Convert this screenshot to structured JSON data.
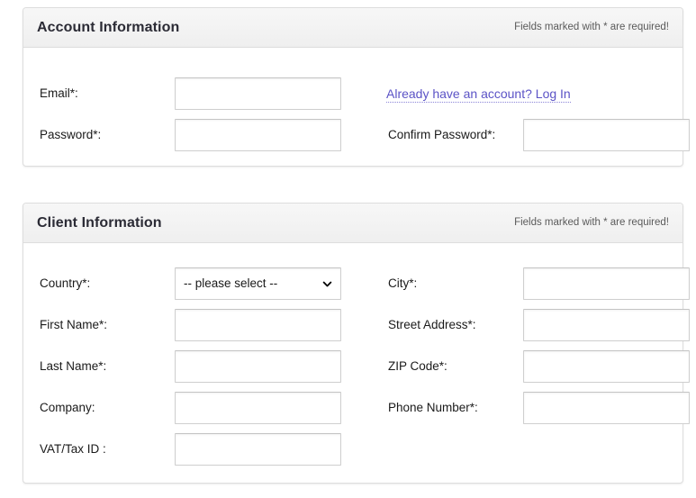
{
  "theme": {
    "panel_border": "#dddddd",
    "header_gradient_top": "#f7f7f7",
    "header_gradient_bottom": "#efefef",
    "title_color": "#2b2b35",
    "link_color": "#5b53c6",
    "input_border": "#cfcfcf",
    "page_background": "#ffffff"
  },
  "panels": [
    {
      "id": "account",
      "title": "Account Information",
      "hint": "Fields marked with * are required!",
      "rows": [
        {
          "left": {
            "kind": "input",
            "label": "Email*:",
            "value": "",
            "placeholder": ""
          },
          "right": {
            "kind": "link",
            "label": "Already have an account? Log In"
          }
        },
        {
          "left": {
            "kind": "input",
            "label": "Password*:",
            "value": "",
            "placeholder": ""
          },
          "right": {
            "kind": "input",
            "label": "Confirm Password*:",
            "value": "",
            "placeholder": ""
          }
        }
      ]
    },
    {
      "id": "client",
      "title": "Client Information",
      "hint": "Fields marked with * are required!",
      "rows": [
        {
          "left": {
            "kind": "select",
            "label": "Country*:",
            "value": "-- please select --",
            "icon": "chevron-down-icon"
          },
          "right": {
            "kind": "input",
            "label": "City*:",
            "value": "",
            "placeholder": ""
          }
        },
        {
          "left": {
            "kind": "input",
            "label": "First Name*:",
            "value": "",
            "placeholder": ""
          },
          "right": {
            "kind": "input",
            "label": "Street Address*:",
            "value": "",
            "placeholder": ""
          }
        },
        {
          "left": {
            "kind": "input",
            "label": "Last Name*:",
            "value": "",
            "placeholder": ""
          },
          "right": {
            "kind": "input",
            "label": "ZIP Code*:",
            "value": "",
            "placeholder": ""
          }
        },
        {
          "left": {
            "kind": "input",
            "label": "Company:",
            "value": "",
            "placeholder": ""
          },
          "right": {
            "kind": "input",
            "label": "Phone Number*:",
            "value": "",
            "placeholder": ""
          }
        },
        {
          "left": {
            "kind": "input",
            "label": "VAT/Tax ID :",
            "value": "",
            "placeholder": ""
          },
          "right": {
            "kind": "empty"
          }
        }
      ]
    }
  ]
}
